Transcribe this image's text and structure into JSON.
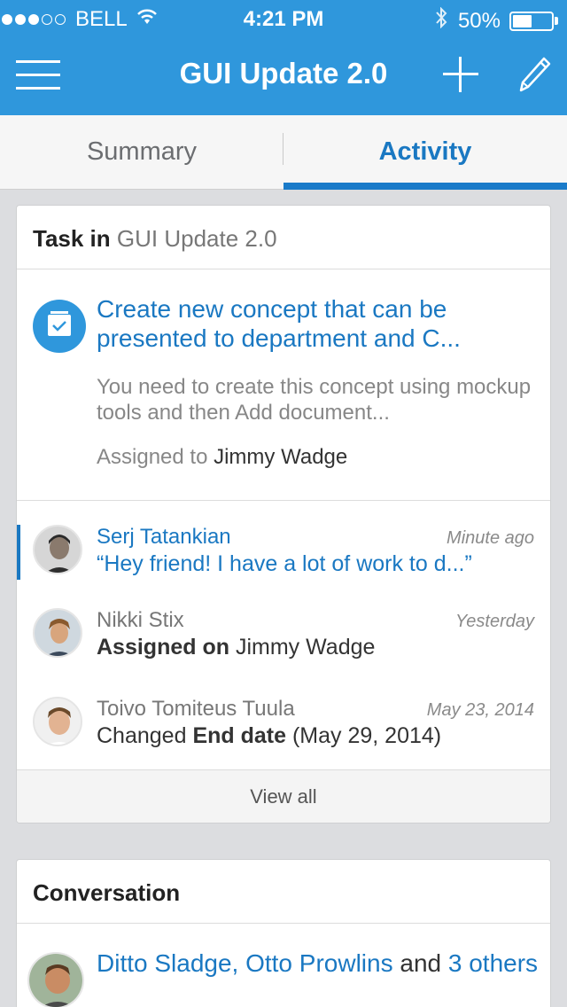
{
  "status_bar": {
    "carrier": "BELL",
    "time": "4:21 PM",
    "battery": "50%",
    "battery_level": 0.5,
    "signal_bars_filled": 3,
    "signal_bars_total": 5
  },
  "navbar": {
    "title": "GUI Update 2.0",
    "menu_icon": "hamburger-menu-icon",
    "add_icon": "plus-icon",
    "edit_icon": "pencil-icon"
  },
  "tabs": [
    {
      "label": "Summary",
      "active": false
    },
    {
      "label": "Activity",
      "active": true
    }
  ],
  "task_card": {
    "header_prefix": "Task in",
    "header_project": "GUI Update 2.0",
    "task_icon": "calendar-check-icon",
    "title": "Create new concept that can be presented to department and C...",
    "description": "You need to create this concept using mockup tools and then Add document...",
    "assigned_label": "Assigned to",
    "assignee": "Jimmy Wadge",
    "activities": [
      {
        "name": "Serj Tatankian",
        "time": "Minute ago",
        "text": "“Hey friend! I have a lot of work to d...”",
        "unread": true
      },
      {
        "name": "Nikki Stix",
        "time": "Yesterday",
        "text_bold": "Assigned on",
        "text_rest": "Jimmy Wadge"
      },
      {
        "name": "Toivo Tomiteus Tuula",
        "time": "May 23, 2014",
        "text_pre": "Changed",
        "text_bold": "End date",
        "text_post": "(May 29, 2014)"
      }
    ],
    "view_all": "View all"
  },
  "conversation_card": {
    "header": "Conversation",
    "participants": "Ditto Sladge, Otto Prowlins",
    "and_word": "and",
    "others_count": "3",
    "others_word": "others"
  },
  "colors": {
    "primary": "#2f97dc",
    "link": "#1a78c2",
    "background": "#dcdde0"
  }
}
